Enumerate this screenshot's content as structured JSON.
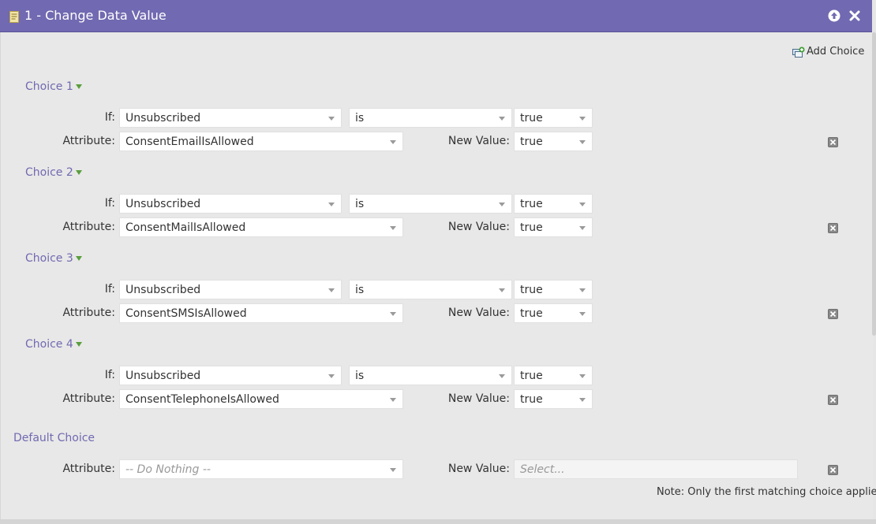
{
  "window": {
    "title": "1 - Change Data Value"
  },
  "toolbar": {
    "add_choice_label": "Add Choice"
  },
  "labels": {
    "if": "If:",
    "attribute": "Attribute:",
    "new_value": "New Value:"
  },
  "choices": [
    {
      "title": "Choice 1",
      "if_field": "Unsubscribed",
      "operator": "is",
      "condition_value": "true",
      "attribute": "ConsentEmailIsAllowed",
      "new_value": "true"
    },
    {
      "title": "Choice 2",
      "if_field": "Unsubscribed",
      "operator": "is",
      "condition_value": "true",
      "attribute": "ConsentMailIsAllowed",
      "new_value": "true"
    },
    {
      "title": "Choice 3",
      "if_field": "Unsubscribed",
      "operator": "is",
      "condition_value": "true",
      "attribute": "ConsentSMSIsAllowed",
      "new_value": "true"
    },
    {
      "title": "Choice 4",
      "if_field": "Unsubscribed",
      "operator": "is",
      "condition_value": "true",
      "attribute": "ConsentTelephoneIsAllowed",
      "new_value": "true"
    }
  ],
  "default_choice": {
    "title": "Default Choice",
    "attribute": "-- Do Nothing --",
    "new_value_placeholder": "Select..."
  },
  "note": "Note: Only the first matching choice applies",
  "colors": {
    "header": "#7169b1",
    "accent_link": "#7169b1",
    "triangle": "#5a9e3d"
  },
  "icons": {
    "header": "flow-step-icon",
    "up": "arrow-up-icon",
    "close": "close-icon",
    "add": "add-choice-icon",
    "remove": "remove-choice-icon"
  }
}
